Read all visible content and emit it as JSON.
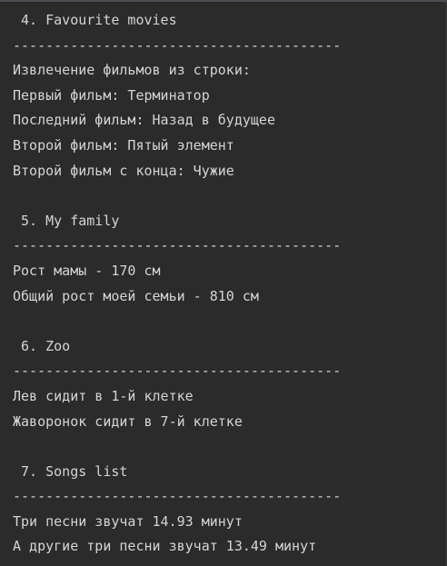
{
  "console": {
    "lines": [
      " 4. Favourite movies",
      "----------------------------------------",
      "Извлечение фильмов из строки:",
      "Первый фильм: Терминатор",
      "Последний фильм: Назад в будущее",
      "Второй фильм: Пятый элемент",
      "Второй фильм с конца: Чужие",
      "",
      " 5. My family",
      "----------------------------------------",
      "Рост мамы - 170 см",
      "Общий рост моей семьи - 810 см",
      "",
      " 6. Zoo",
      "----------------------------------------",
      "Лев сидит в 1-й клетке",
      "Жаворонок сидит в 7-й клетке",
      "",
      " 7. Songs list",
      "----------------------------------------",
      "Три песни звучат 14.93 минут",
      "А другие три песни звучат 13.49 минут"
    ]
  },
  "colors": {
    "background": "#2b2b2b",
    "text": "#d4d4d4"
  }
}
